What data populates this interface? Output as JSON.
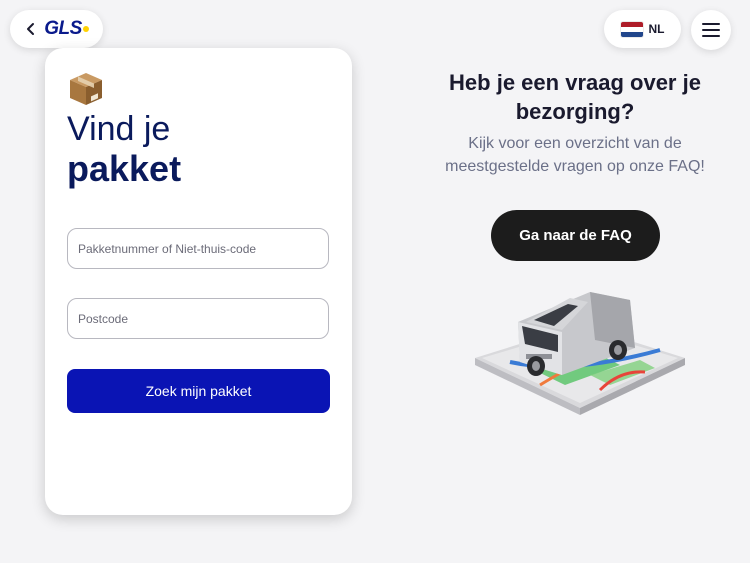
{
  "header": {
    "logo_text": "GLS",
    "language_label": "NL",
    "flag_colors": [
      "#ae1c28",
      "#ffffff",
      "#21468b"
    ]
  },
  "card": {
    "title_line1": "Vind je",
    "title_line2": "pakket",
    "parcel_field": {
      "placeholder": "Pakketnummer of Niet-thuis-code",
      "value": ""
    },
    "postcode_field": {
      "placeholder": "Postcode",
      "value": ""
    },
    "search_button_label": "Zoek mijn pakket"
  },
  "faq": {
    "title": "Heb je een vraag over je bezorging?",
    "subtitle": "Kijk voor een overzicht van de meestgestelde vragen op onze FAQ!",
    "button_label": "Ga naar de FAQ"
  },
  "colors": {
    "brand_blue": "#0a14b4",
    "brand_yellow": "#ffd100",
    "dark_button": "#1c1c1c"
  }
}
